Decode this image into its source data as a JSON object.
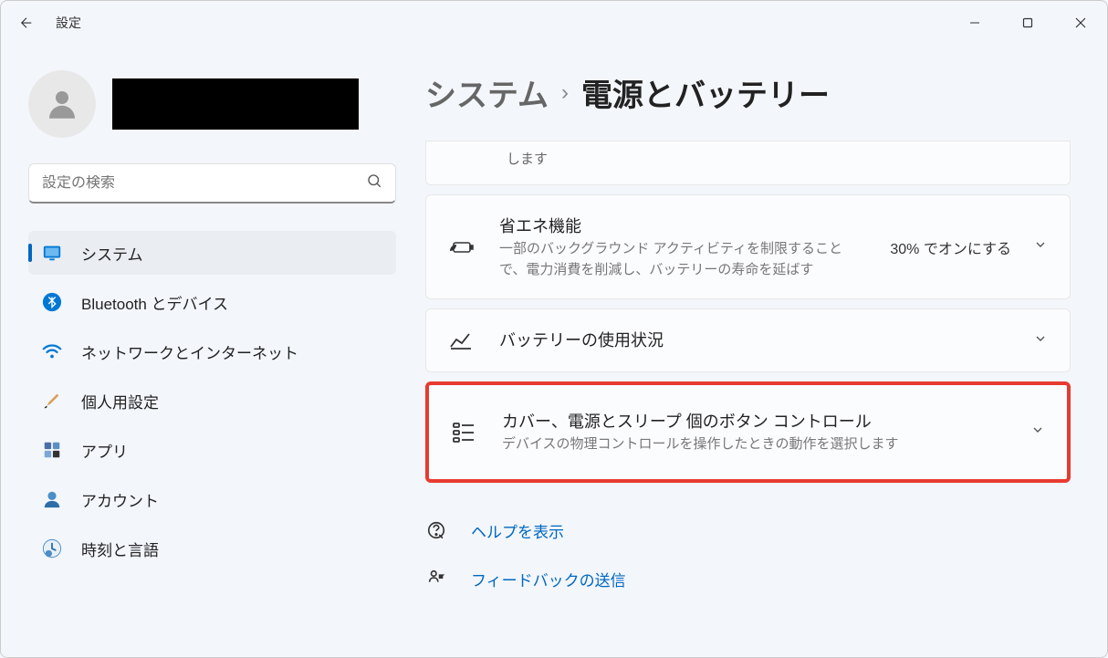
{
  "titlebar": {
    "app_title": "設定"
  },
  "search": {
    "placeholder": "設定の検索"
  },
  "nav": {
    "items": [
      {
        "label": "システム"
      },
      {
        "label": "Bluetooth とデバイス"
      },
      {
        "label": "ネットワークとインターネット"
      },
      {
        "label": "個人用設定"
      },
      {
        "label": "アプリ"
      },
      {
        "label": "アカウント"
      },
      {
        "label": "時刻と言語"
      }
    ]
  },
  "breadcrumb": {
    "parent": "システム",
    "current": "電源とバッテリー"
  },
  "cards": {
    "partial_top": "します",
    "energy": {
      "title": "省エネ機能",
      "desc": "一部のバックグラウンド アクティビティを制限することで、電力消費を削減し、バッテリーの寿命を延ばす",
      "value": "30% でオンにする"
    },
    "battery_usage": {
      "title": "バッテリーの使用状況"
    },
    "lid_power": {
      "title": "カバー、電源とスリープ 個のボタン コントロール",
      "desc": "デバイスの物理コントロールを操作したときの動作を選択します"
    }
  },
  "help": {
    "show_help": "ヘルプを表示",
    "feedback": "フィードバックの送信"
  }
}
